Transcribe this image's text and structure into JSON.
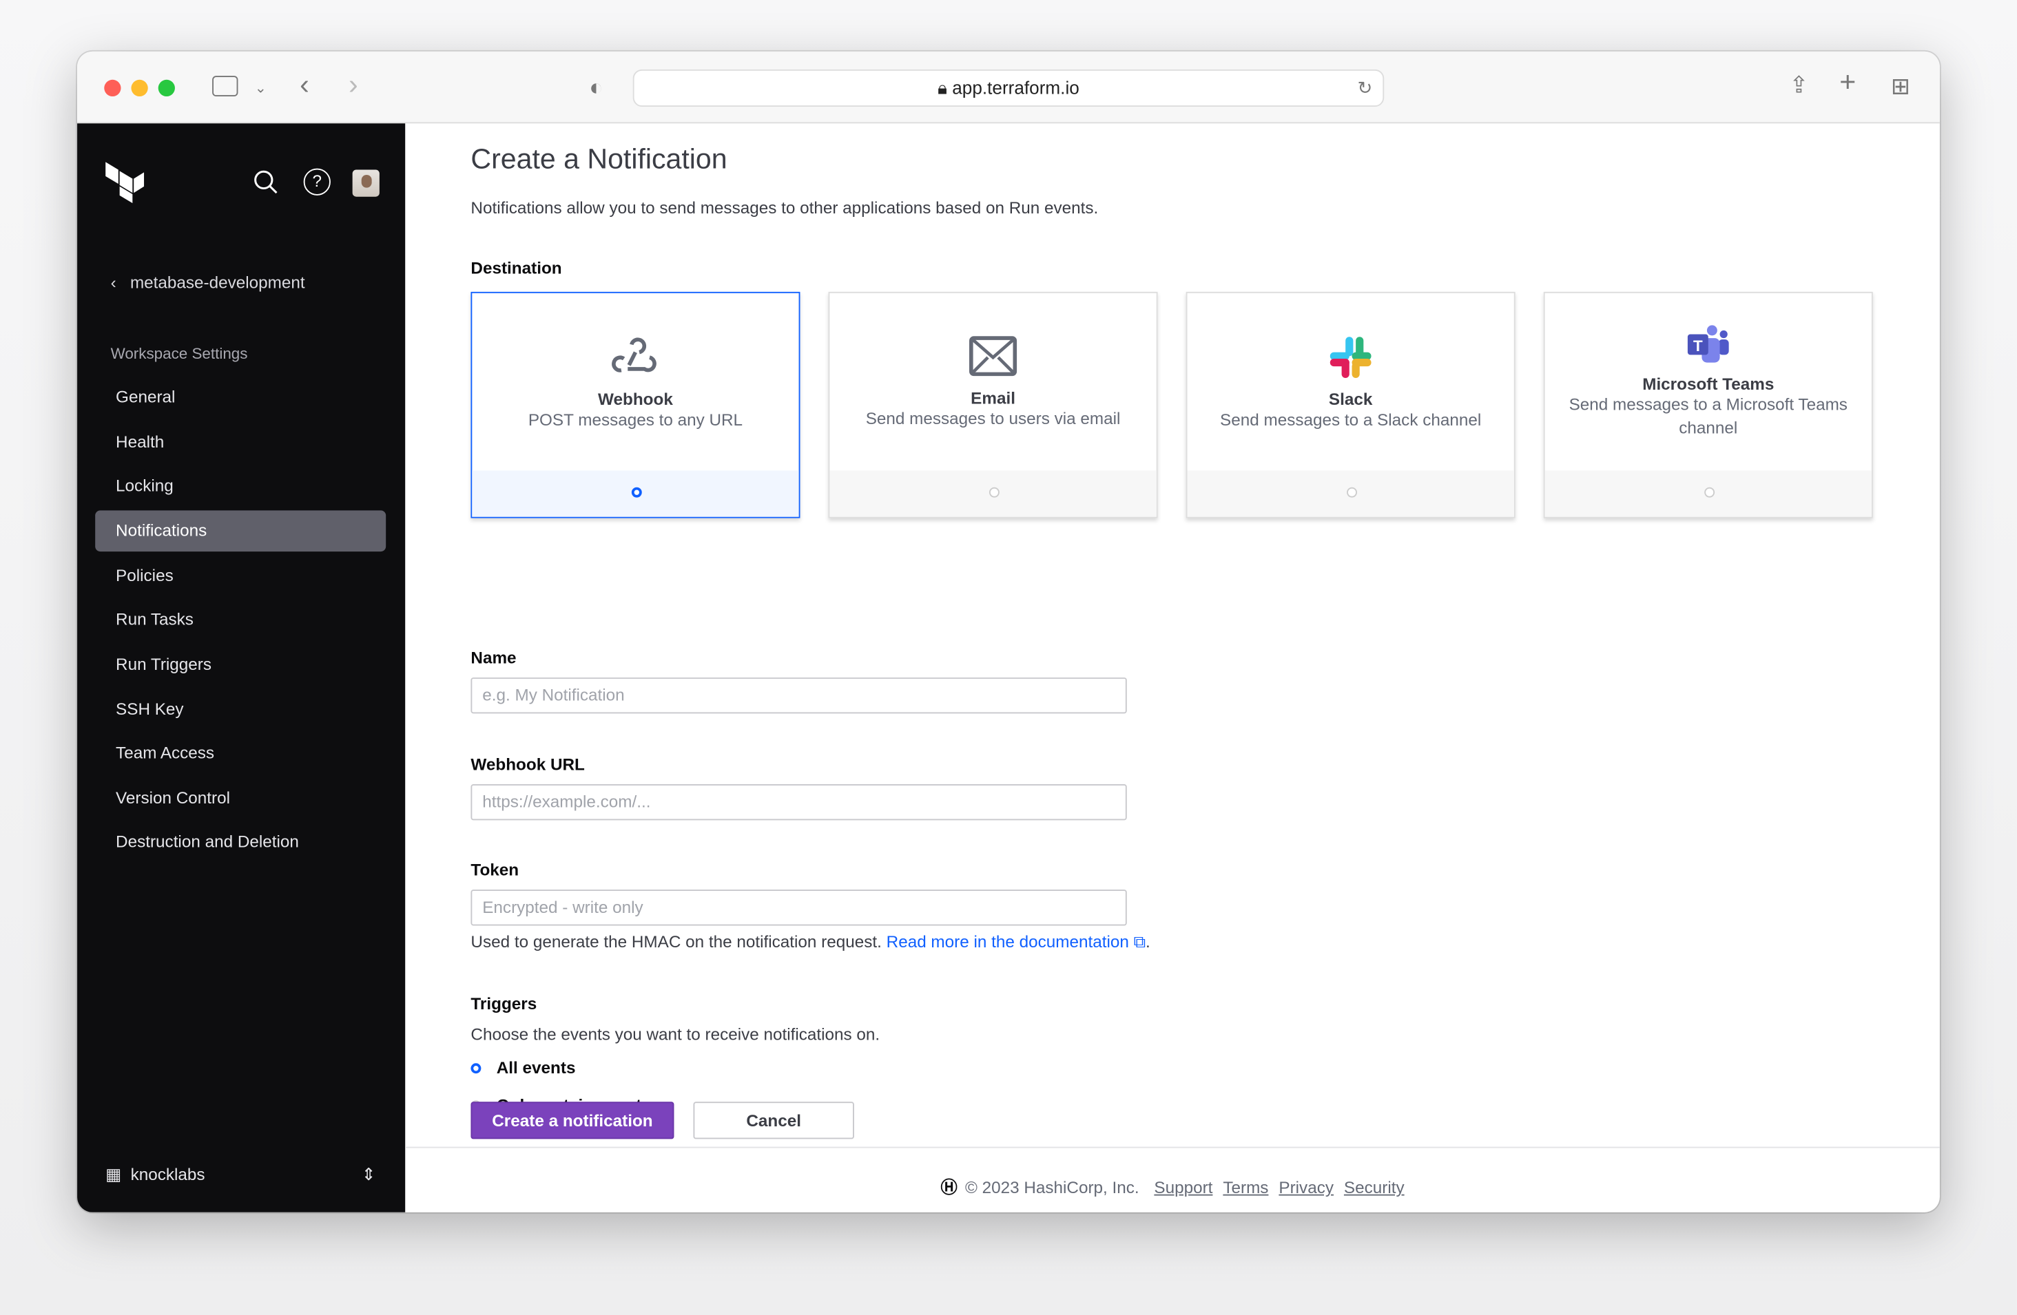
{
  "browser": {
    "url": "app.terraform.io"
  },
  "sidebar": {
    "back_label": "metabase-development",
    "section": "Workspace Settings",
    "items": [
      {
        "label": "General"
      },
      {
        "label": "Health"
      },
      {
        "label": "Locking"
      },
      {
        "label": "Notifications",
        "active": true
      },
      {
        "label": "Policies"
      },
      {
        "label": "Run Tasks"
      },
      {
        "label": "Run Triggers"
      },
      {
        "label": "SSH Key"
      },
      {
        "label": "Team Access"
      },
      {
        "label": "Version Control"
      },
      {
        "label": "Destruction and Deletion"
      }
    ],
    "org": "knocklabs"
  },
  "main": {
    "title": "Create a Notification",
    "description": "Notifications allow you to send messages to other applications based on Run events.",
    "destination_label": "Destination",
    "destinations": [
      {
        "title": "Webhook",
        "desc": "POST messages to any URL",
        "selected": true
      },
      {
        "title": "Email",
        "desc": "Send messages to users via email"
      },
      {
        "title": "Slack",
        "desc": "Send messages to a Slack channel"
      },
      {
        "title": "Microsoft Teams",
        "desc": "Send messages to a Microsoft Teams channel"
      }
    ],
    "name_label": "Name",
    "name_placeholder": "e.g. My Notification",
    "url_label": "Webhook URL",
    "url_placeholder": "https://example.com/...",
    "token_label": "Token",
    "token_placeholder": "Encrypted - write only",
    "token_help": "Used to generate the HMAC on the notification request.",
    "token_link": "Read more in the documentation",
    "triggers_label": "Triggers",
    "triggers_help": "Choose the events you want to receive notifications on.",
    "trigger_options": [
      {
        "label": "All events",
        "selected": true
      },
      {
        "label": "Only certain events"
      }
    ],
    "create_button": "Create a notification",
    "cancel_button": "Cancel"
  },
  "footer": {
    "copyright": "© 2023 HashiCorp, Inc.",
    "links": [
      "Support",
      "Terms",
      "Privacy",
      "Security"
    ]
  },
  "colors": {
    "accent": "#1060ff",
    "primary_button": "#7b42bc",
    "sidebar": "#0d0d0f"
  }
}
